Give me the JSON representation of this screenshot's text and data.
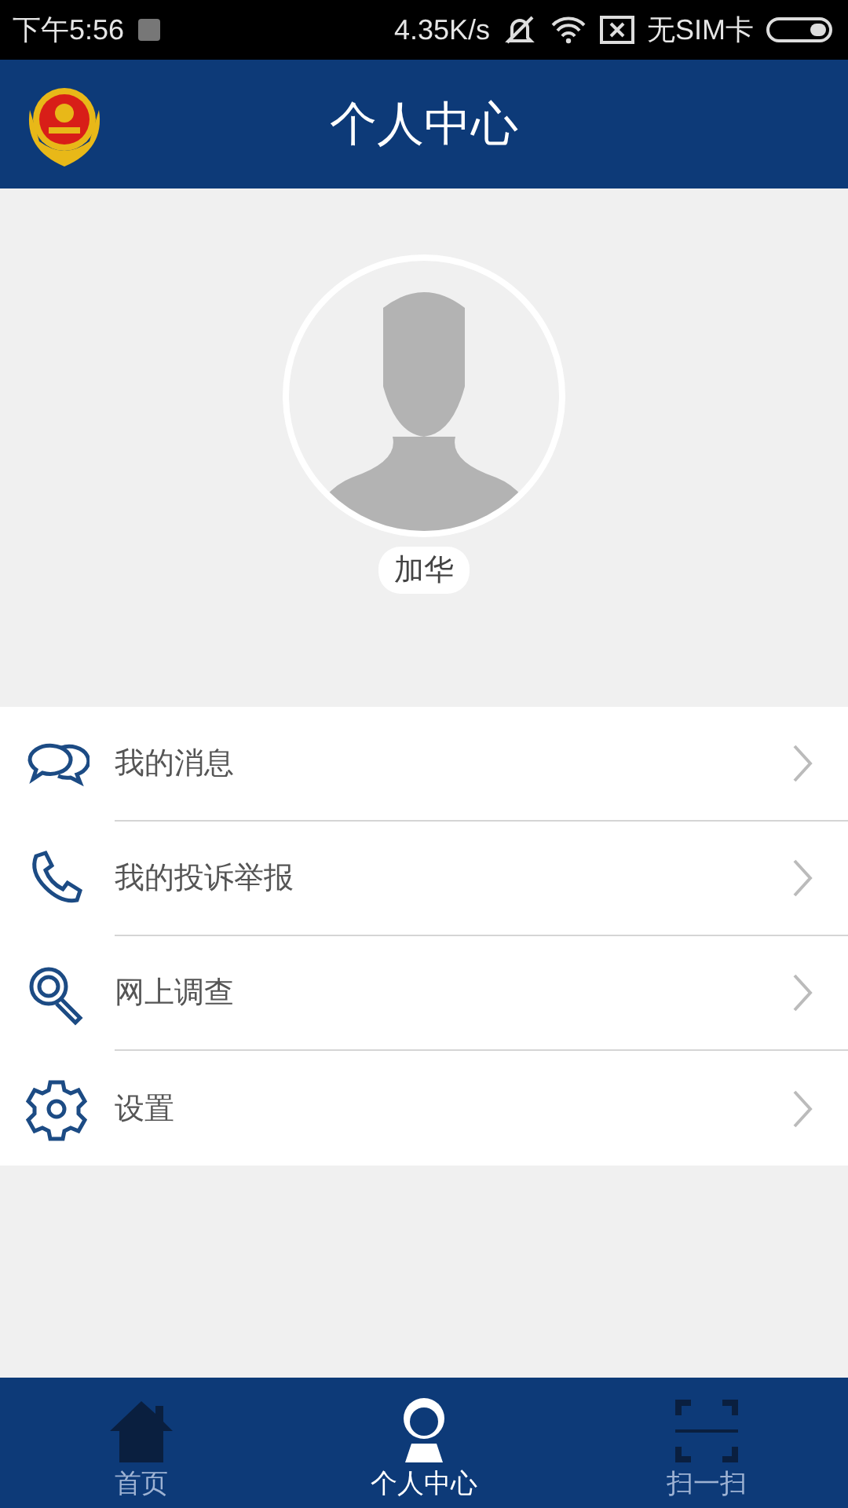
{
  "status_bar": {
    "time": "下午5:56",
    "speed": "4.35K/s",
    "sim": "无SIM卡"
  },
  "header": {
    "title": "个人中心"
  },
  "profile": {
    "name": "加华"
  },
  "menu": [
    {
      "kind": "messages",
      "label": "我的消息"
    },
    {
      "kind": "phone",
      "label": "我的投诉举报"
    },
    {
      "kind": "search",
      "label": "网上调查"
    },
    {
      "kind": "settings",
      "label": "设置"
    }
  ],
  "tabs": [
    {
      "kind": "home",
      "label": "首页",
      "selected": false
    },
    {
      "kind": "profile",
      "label": "个人中心",
      "selected": true
    },
    {
      "kind": "scan",
      "label": "扫一扫",
      "selected": false
    }
  ]
}
